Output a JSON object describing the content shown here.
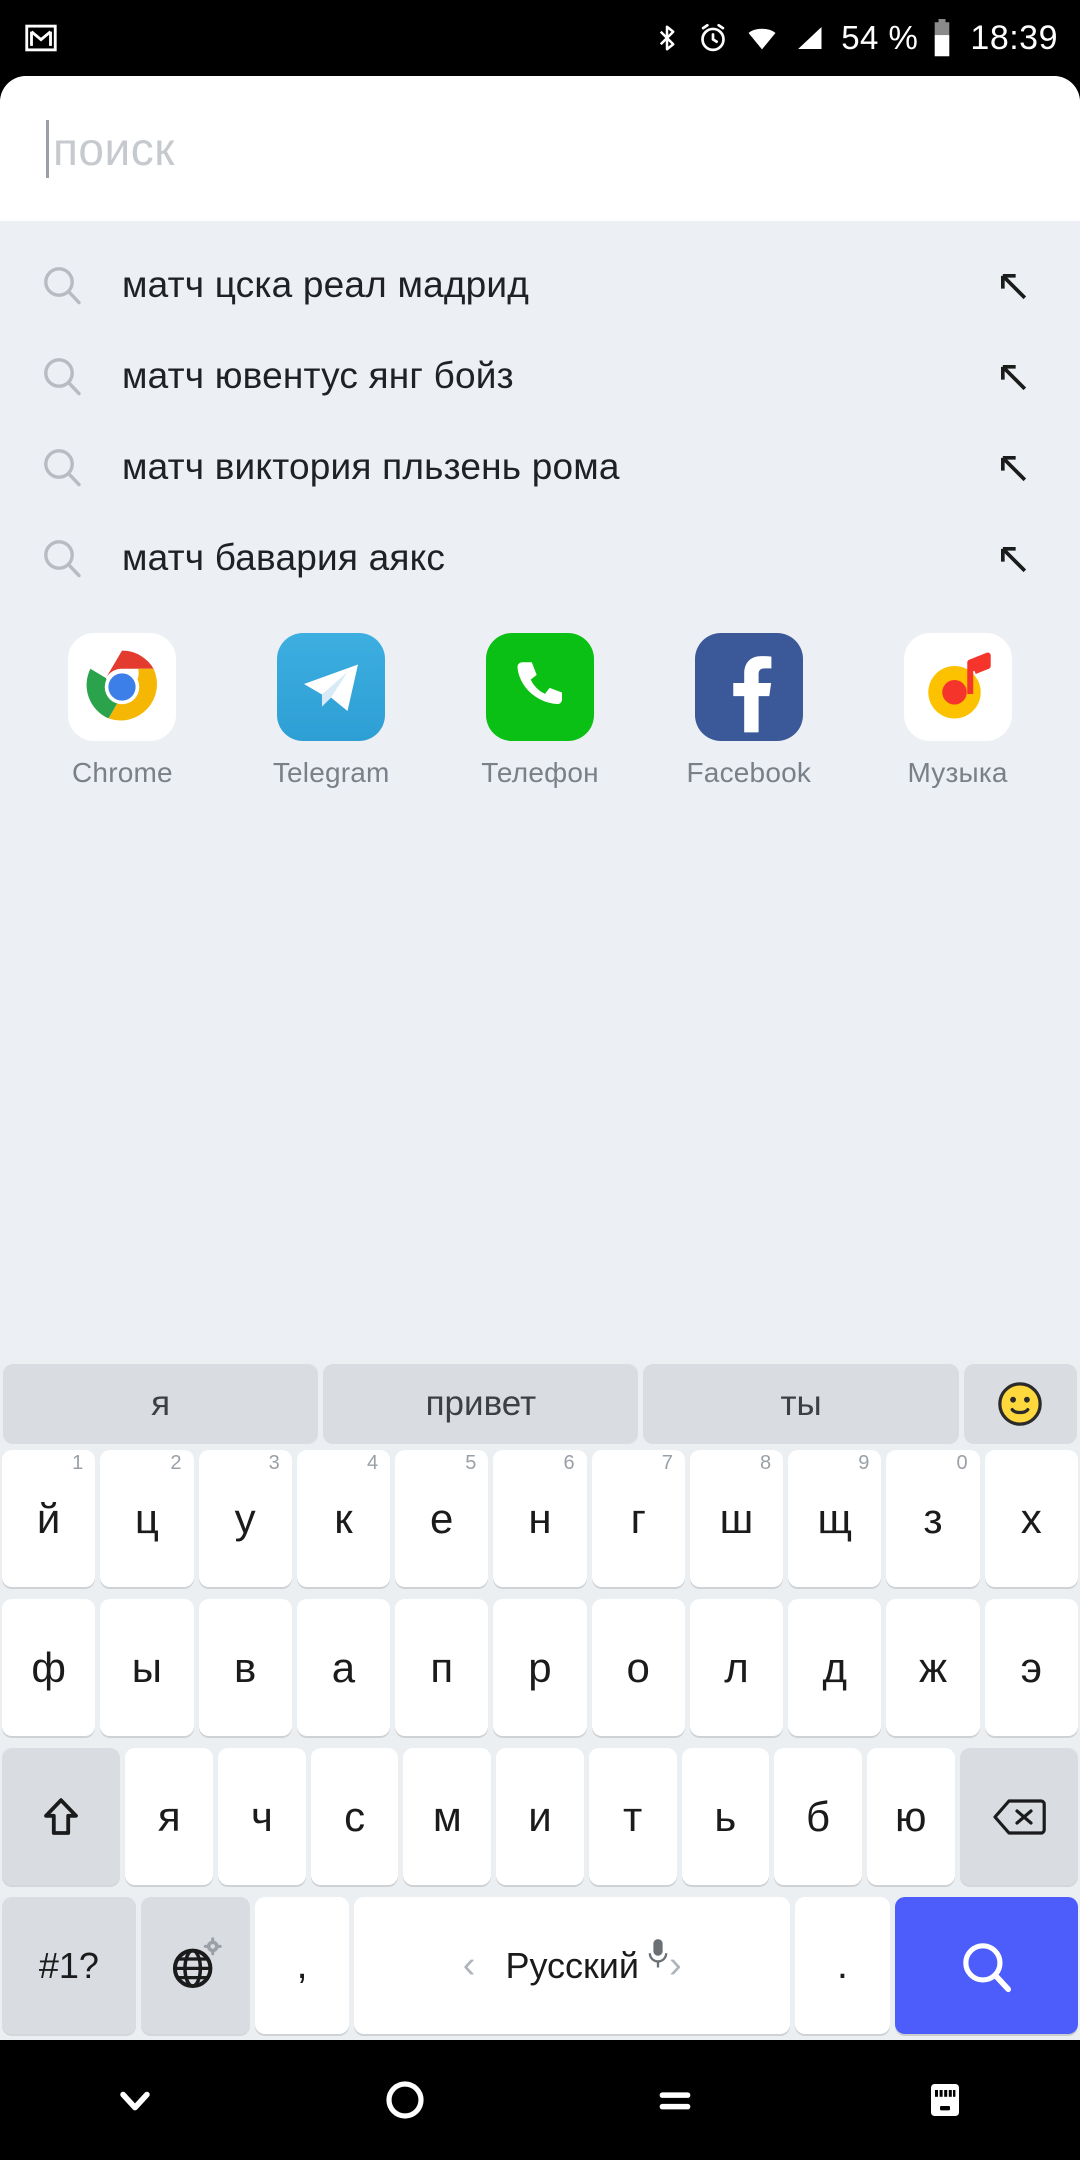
{
  "status_bar": {
    "notification_icon": "gmail-icon",
    "icons": [
      "bluetooth-icon",
      "alarm-icon",
      "wifi-icon",
      "cellular-signal-icon"
    ],
    "battery_percent": "54 %",
    "battery_icon": "battery-icon",
    "clock": "18:39"
  },
  "search": {
    "placeholder": "поиск",
    "value": "",
    "icon": "search-icon"
  },
  "suggestions": [
    {
      "text": "матч цска реал мадрид",
      "icon": "search-icon",
      "action_icon": "arrow-up-left-icon"
    },
    {
      "text": "матч ювентус янг бойз",
      "icon": "search-icon",
      "action_icon": "arrow-up-left-icon"
    },
    {
      "text": "матч виктория пльзень рома",
      "icon": "search-icon",
      "action_icon": "arrow-up-left-icon"
    },
    {
      "text": "матч бавария аякс",
      "icon": "search-icon",
      "action_icon": "arrow-up-left-icon"
    }
  ],
  "apps": [
    {
      "label": "Chrome",
      "icon": "chrome-icon"
    },
    {
      "label": "Telegram",
      "icon": "telegram-icon"
    },
    {
      "label": "Телефон",
      "icon": "phone-icon"
    },
    {
      "label": "Facebook",
      "icon": "facebook-icon"
    },
    {
      "label": "Музыка",
      "icon": "music-icon"
    }
  ],
  "keyboard": {
    "suggestion_strip": [
      "я",
      "привет",
      "ты"
    ],
    "emoji_button_icon": "smiley-icon",
    "row1": [
      {
        "key": "й",
        "num": "1"
      },
      {
        "key": "ц",
        "num": "2"
      },
      {
        "key": "у",
        "num": "3"
      },
      {
        "key": "к",
        "num": "4"
      },
      {
        "key": "е",
        "num": "5"
      },
      {
        "key": "н",
        "num": "6"
      },
      {
        "key": "г",
        "num": "7"
      },
      {
        "key": "ш",
        "num": "8"
      },
      {
        "key": "щ",
        "num": "9"
      },
      {
        "key": "з",
        "num": "0"
      },
      {
        "key": "х",
        "num": ""
      }
    ],
    "row2": [
      "ф",
      "ы",
      "в",
      "а",
      "п",
      "р",
      "о",
      "л",
      "д",
      "ж",
      "э"
    ],
    "row3": {
      "shift_icon": "shift-up-icon",
      "letters": [
        "я",
        "ч",
        "с",
        "м",
        "и",
        "т",
        "ь",
        "б",
        "ю"
      ],
      "backspace_icon": "backspace-icon"
    },
    "row4": {
      "symbols_label": "#1?",
      "globe_icon": "globe-icon",
      "gear_icon": "gear-icon",
      "comma": ",",
      "space_label": "Русский",
      "space_prev_icon": "chevron-left-icon",
      "space_next_icon": "chevron-right-icon",
      "mic_icon": "microphone-icon",
      "period": ".",
      "search_icon": "search-icon"
    },
    "accent_color": "#4d5dfb"
  },
  "nav_bar": {
    "back_icon": "chevron-down-icon",
    "home_icon": "circle-home-icon",
    "recents_icon": "recents-icon",
    "keyboard_icon": "keyboard-icon"
  }
}
